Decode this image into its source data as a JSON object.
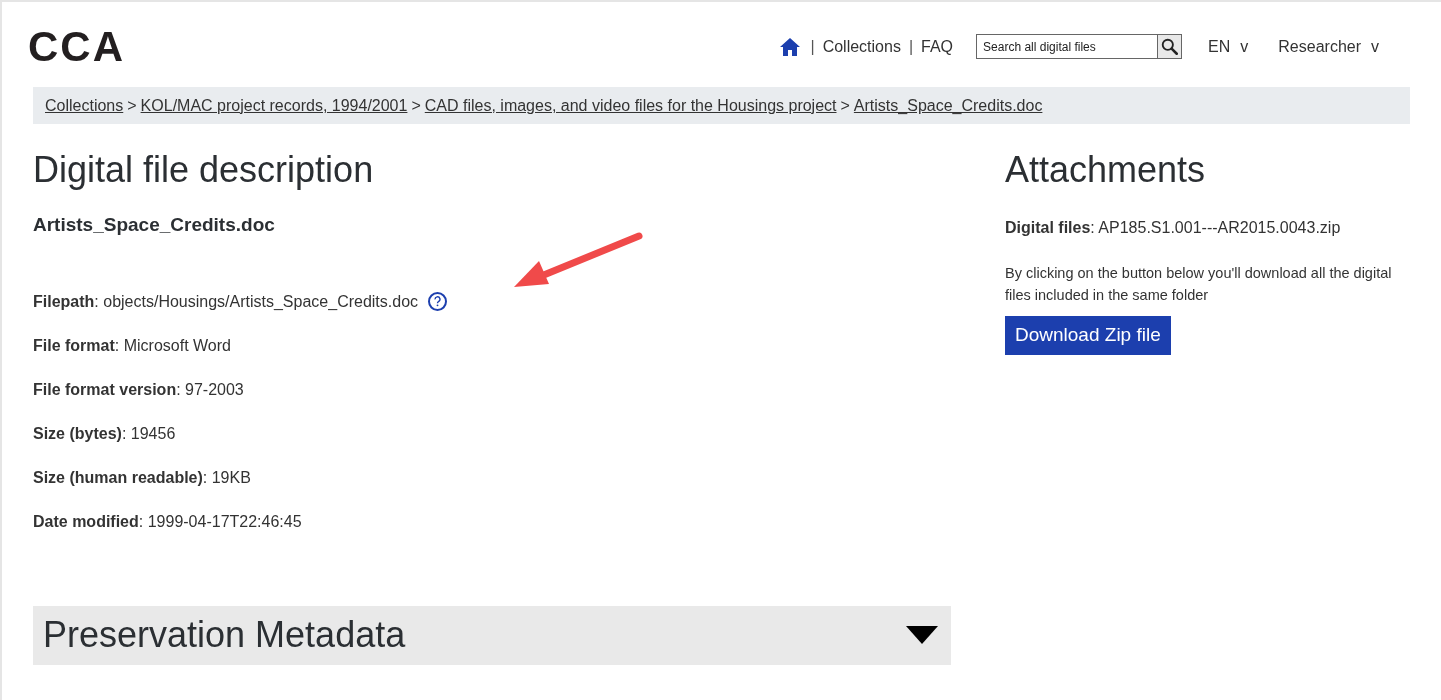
{
  "header": {
    "logo": "CCA",
    "nav": [
      {
        "kind": "home"
      },
      {
        "kind": "link",
        "label": "Collections"
      },
      {
        "kind": "link",
        "label": "FAQ"
      }
    ],
    "nav_separator": "|",
    "search": {
      "placeholder": "Search all digital files"
    },
    "menus": [
      {
        "label": "EN",
        "caret": "v"
      },
      {
        "label": "Researcher",
        "caret": "v"
      }
    ]
  },
  "breadcrumb": {
    "separator": ">",
    "items": [
      "Collections",
      "KOL/MAC project records, 1994/2001",
      "CAD files, images, and video files for the Housings project",
      "Artists_Space_Credits.doc"
    ]
  },
  "description": {
    "title": "Digital file description",
    "file_name": "Artists_Space_Credits.doc",
    "fields": [
      {
        "text": "**Filepath**: objects/Housings/Artists_Space_Credits.doc",
        "help_icon": true
      },
      {
        "text": "**File format**: Microsoft Word",
        "help_icon": false
      },
      {
        "text": "**File format version**: 97-2003",
        "help_icon": false
      },
      {
        "text": "**Size (bytes)**: 19456",
        "help_icon": false
      },
      {
        "text": "**Size (human readable)**: 19KB",
        "help_icon": false
      },
      {
        "text": "**Date modified**: 1999-04-17T22:46:45",
        "help_icon": false
      }
    ]
  },
  "attachments": {
    "title": "Attachments",
    "digital_files": "**Digital files**: AP185.S1.001---AR2015.0043.zip",
    "note": "By clicking on the button below you'll download all the digital files included in the same folder",
    "button": "Download Zip file"
  },
  "preservation": {
    "title": "Preservation Metadata",
    "expanded": false
  }
}
